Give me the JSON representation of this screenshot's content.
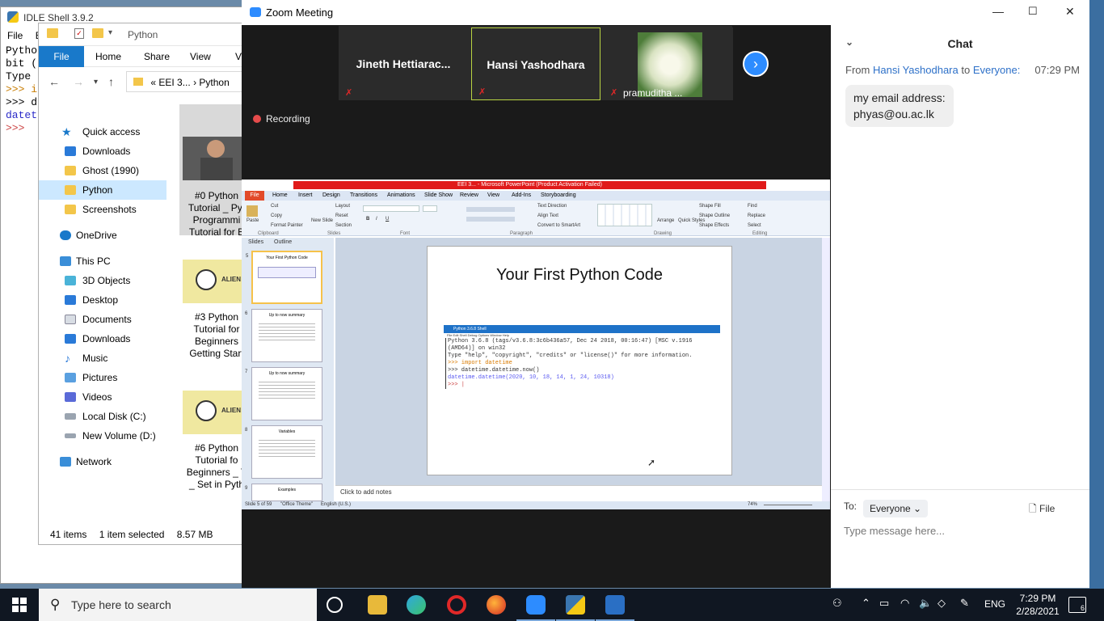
{
  "idle": {
    "title": "IDLE Shell 3.9.2",
    "menu": [
      "File",
      "E"
    ],
    "lines": [
      "Pytho",
      "bit (",
      "Type",
      ">>> i",
      ">>> d",
      "datet",
      ">>>"
    ]
  },
  "explorer": {
    "quick_title": "Python",
    "ribbon": {
      "file": "File",
      "home": "Home",
      "share": "Share",
      "view": "View",
      "more": "Vi"
    },
    "address": [
      "«",
      "EEI 3...",
      "›",
      "Python"
    ],
    "tree": [
      {
        "label": "Quick access",
        "icon": "star-icon"
      },
      {
        "label": "Downloads",
        "icon": "download-icon"
      },
      {
        "label": "Ghost (1990)",
        "icon": "folder-icon"
      },
      {
        "label": "Python",
        "icon": "folder-icon",
        "selected": true
      },
      {
        "label": "Screenshots",
        "icon": "folder-icon"
      },
      {
        "label": "OneDrive",
        "icon": "cloud-icon"
      },
      {
        "label": "This PC",
        "icon": "computer-icon"
      },
      {
        "label": "3D Objects",
        "icon": "cube-icon"
      },
      {
        "label": "Desktop",
        "icon": "desktop-icon"
      },
      {
        "label": "Documents",
        "icon": "document-icon"
      },
      {
        "label": "Downloads",
        "icon": "download-icon"
      },
      {
        "label": "Music",
        "icon": "music-icon"
      },
      {
        "label": "Pictures",
        "icon": "pictures-icon"
      },
      {
        "label": "Videos",
        "icon": "videos-icon"
      },
      {
        "label": "Local Disk (C:)",
        "icon": "disk-icon"
      },
      {
        "label": "New Volume (D:)",
        "icon": "disk-icon"
      },
      {
        "label": "Network",
        "icon": "network-icon"
      }
    ],
    "files": [
      {
        "caption": [
          "#0 Python",
          "Tutorial _ Pyt",
          "Programmi",
          "Tutorial for B"
        ]
      },
      {
        "caption": [
          "#3 Python",
          "Tutorial for",
          "Beginners",
          "Getting Start"
        ]
      },
      {
        "caption": [
          "#6 Python",
          "Tutorial fo",
          "Beginners _ T",
          "_ Set in Pyth"
        ]
      }
    ],
    "thumb_label": "ALIEN",
    "status": {
      "items": "41 items",
      "selected": "1 item selected",
      "size": "8.57 MB"
    }
  },
  "zoom": {
    "title": "Zoom Meeting",
    "participants": [
      "Jineth  Hettiarac...",
      "Hansi Yashodhara",
      "pramuditha ..."
    ],
    "recording": "Recording",
    "chat": {
      "header": "Chat",
      "from_prefix": "From",
      "sender": "Hansi Yashodhara",
      "to_word": "to",
      "recipient": "Everyone:",
      "time": "07:29 PM",
      "message_lines": [
        "my email address:",
        "phyas@ou.ac.lk"
      ],
      "to_label": "To:",
      "to_value": "Everyone",
      "file_label": "File",
      "input_placeholder": "Type message here..."
    }
  },
  "ppt": {
    "window_title": "EEI 3... - Microsoft PowerPoint (Product Activation Failed)",
    "tabs": [
      "File",
      "Home",
      "Insert",
      "Design",
      "Transitions",
      "Animations",
      "Slide Show",
      "Review",
      "View",
      "Add-Ins",
      "Storyboarding"
    ],
    "groups": [
      "Clipboard",
      "Slides",
      "Font",
      "Paragraph",
      "Drawing",
      "Editing"
    ],
    "ribbon_items": [
      "Paste",
      "Cut",
      "Copy",
      "Format Painter",
      "New Slide",
      "Layout",
      "Reset",
      "Section",
      "Text Direction",
      "Align Text",
      "Convert to SmartArt",
      "Arrange",
      "Quick Styles",
      "Shape Fill",
      "Shape Outline",
      "Shape Effects",
      "Find",
      "Replace",
      "Select"
    ],
    "panel_tabs": [
      "Slides",
      "Outline"
    ],
    "thumbs": [
      {
        "num": "5",
        "title": "Your First Python Code"
      },
      {
        "num": "6",
        "title": "Up to now summary"
      },
      {
        "num": "7",
        "title": "Up to now summary"
      },
      {
        "num": "8",
        "title": "Variables"
      },
      {
        "num": "9",
        "title": "Examples"
      }
    ],
    "slide_title": "Your First Python Code",
    "shot_title": "Python 3.6.8 Shell",
    "shot_menu": "File  Edit  Shell  Debug  Options  Window  Help",
    "shot_lines": [
      "Python 3.6.8 (tags/v3.6.8:3c6b436a57, Dec 24 2018, 00:16:47) [MSC v.1916",
      "(AMD64)] on win32",
      "Type \"help\", \"copyright\", \"credits\" or \"license()\" for more information.",
      ">>> import datetime",
      ">>> datetime.datetime.now()",
      "datetime.datetime(2020, 10, 18, 14, 1, 24, 10318)",
      ">>> |"
    ],
    "notes": "Click to add notes",
    "status": {
      "slide": "Slide 5 of 59",
      "theme": "\"Office Theme\"",
      "lang": "English (U.S.)",
      "zoom": "74%"
    }
  },
  "taskbar": {
    "search_placeholder": "Type here to search",
    "lang": "ENG",
    "time": "7:29 PM",
    "date": "2/28/2021",
    "notifications": "6"
  }
}
